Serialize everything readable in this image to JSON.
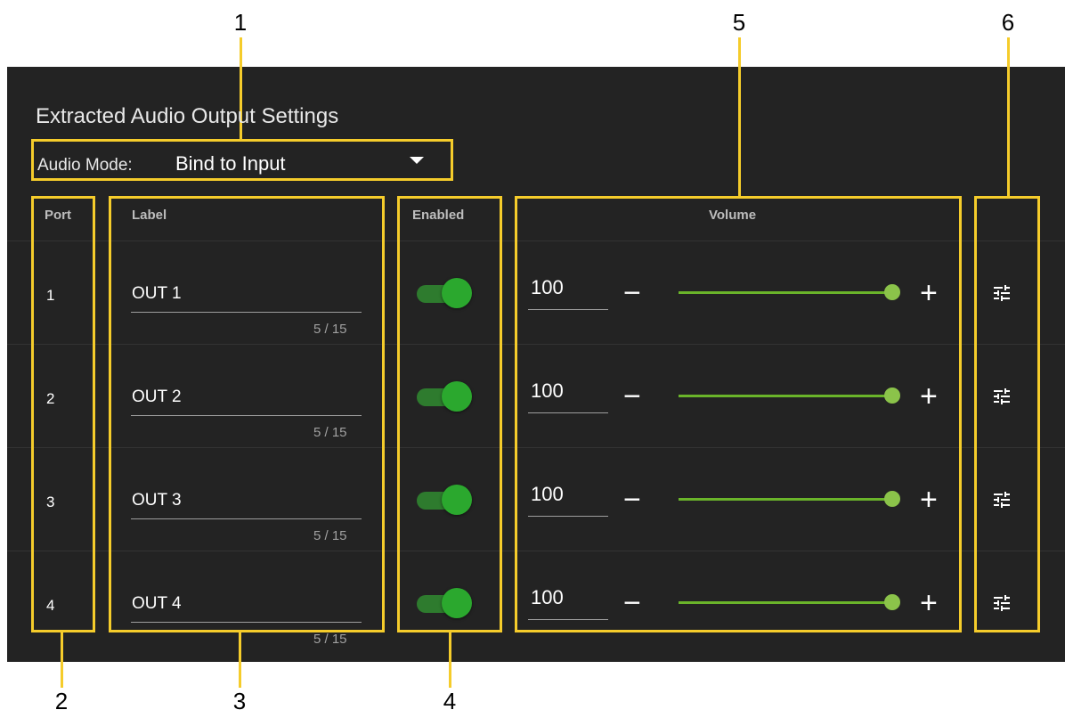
{
  "callouts": [
    "1",
    "2",
    "3",
    "4",
    "5",
    "6"
  ],
  "panel": {
    "title": "Extracted Audio Output Settings",
    "audio_mode_label": "Audio Mode:",
    "audio_mode_value": "Bind to Input",
    "dropdown_icon": "caret-down-icon"
  },
  "table": {
    "headers": {
      "port": "Port",
      "label": "Label",
      "enabled": "Enabled",
      "volume": "Volume"
    },
    "rows": [
      {
        "port": "1",
        "label": "OUT 1",
        "counter": "5 / 15",
        "enabled": true,
        "volume": "100",
        "volume_fraction": 1.0
      },
      {
        "port": "2",
        "label": "OUT 2",
        "counter": "5 / 15",
        "enabled": true,
        "volume": "100",
        "volume_fraction": 1.0
      },
      {
        "port": "3",
        "label": "OUT 3",
        "counter": "5 / 15",
        "enabled": true,
        "volume": "100",
        "volume_fraction": 1.0
      },
      {
        "port": "4",
        "label": "OUT 4",
        "counter": "5 / 15",
        "enabled": true,
        "volume": "100",
        "volume_fraction": 1.0
      }
    ],
    "minus_symbol": "−",
    "plus_symbol": "+",
    "settings_icon": "tune-icon"
  },
  "colors": {
    "highlight": "#f5cc2b",
    "panel": "#232323",
    "toggle_on": "#2ba82e",
    "slider": "#8bc34a"
  }
}
